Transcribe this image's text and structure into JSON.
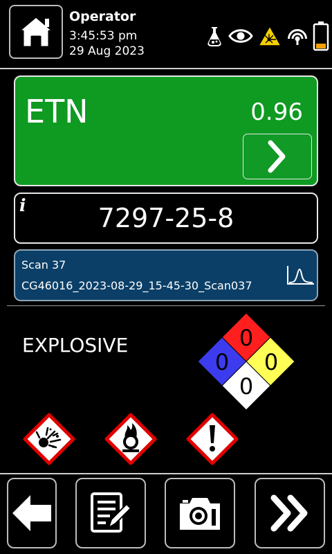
{
  "header": {
    "user": "Operator",
    "time": "3:45:53 pm",
    "date": "29 Aug 2023",
    "status_icons": [
      "flask-icon",
      "eye-icon",
      "laser-warning-icon",
      "wireless-signal-icon",
      "battery-low-icon"
    ],
    "battery_level": 0.2
  },
  "result": {
    "name": "ETN",
    "score": "0.96",
    "card_color": "#0f9a22"
  },
  "cas": {
    "info_symbol": "i",
    "number": "7297-25-8"
  },
  "scan": {
    "title": "Scan 37",
    "filename": "CG46016_2023-08-29_15-45-30_Scan037"
  },
  "hazard": {
    "class": "EXPLOSIVE",
    "nfpa": {
      "health": "0",
      "flammability": "0",
      "instability": "0",
      "special": "0",
      "colors": {
        "health": "#3c3cee",
        "flammability": "#ff1f1f",
        "instability": "#ffff55",
        "special": "#ffffff"
      }
    },
    "ghs_pictograms": [
      "exploding-bomb-icon",
      "oxidizer-flame-over-circle-icon",
      "exclamation-mark-icon"
    ]
  },
  "nav": {
    "buttons": [
      "back-arrow-icon",
      "edit-report-icon",
      "camera-icon",
      "double-chevron-next-icon"
    ]
  }
}
